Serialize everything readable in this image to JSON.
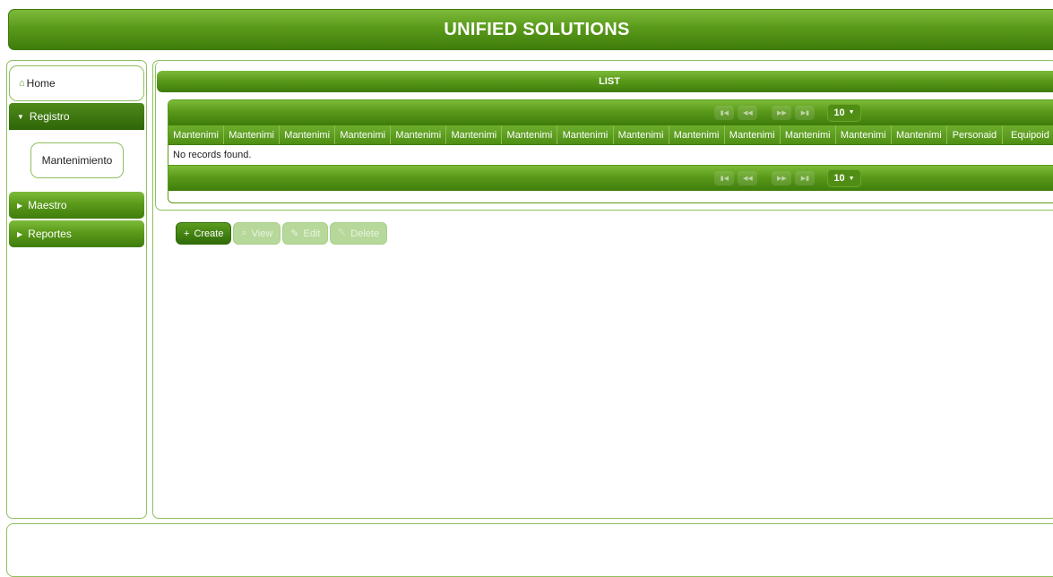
{
  "header": {
    "title": "UNIFIED SOLUTIONS"
  },
  "sidebar": {
    "home": {
      "icon": "home-icon",
      "label": "Home"
    },
    "registro": {
      "label": "Registro",
      "expanded": true,
      "items": [
        {
          "label": "Mantenimiento"
        }
      ]
    },
    "maestro": {
      "label": "Maestro"
    },
    "reportes": {
      "label": "Reportes"
    }
  },
  "list": {
    "title": "LIST",
    "rows_per_page": "10",
    "columns": [
      "Mantenimi",
      "Mantenimi",
      "Mantenimi",
      "Mantenimi",
      "Mantenimi",
      "Mantenimi",
      "Mantenimi",
      "Mantenimi",
      "Mantenimi",
      "Mantenimi",
      "Mantenimi",
      "Mantenimi",
      "Mantenimi",
      "Mantenimi",
      "Personaid",
      "Equipoid"
    ],
    "empty_message": "No records found."
  },
  "actions": {
    "create": "Create",
    "view": "View",
    "edit": "Edit",
    "delete": "Delete"
  },
  "colors": {
    "primary": "#4f8d14",
    "dark": "#2f6b08",
    "border": "#8fbf5e",
    "disabled": "#b6d89a"
  }
}
